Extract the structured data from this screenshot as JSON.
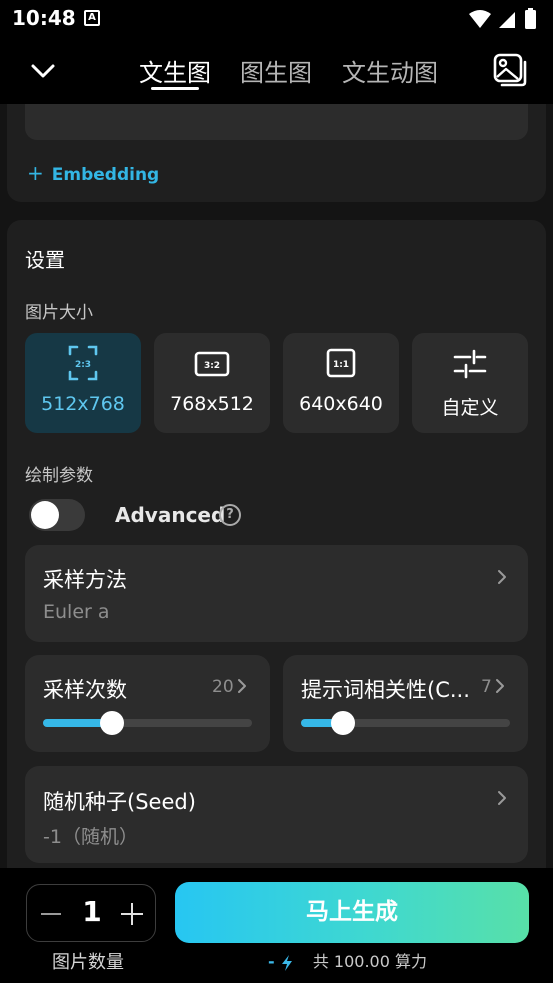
{
  "status_bar": {
    "time": "10:48",
    "notification_glyph": "A"
  },
  "nav": {
    "tabs": [
      {
        "label": "文生图",
        "active": true
      },
      {
        "label": "图生图",
        "active": false
      },
      {
        "label": "文生动图",
        "active": false
      }
    ]
  },
  "prompt_card": {
    "embedding_label": "Embedding",
    "embedding_plus": "+"
  },
  "settings": {
    "title": "设置",
    "size_label": "图片大小",
    "size_options": [
      {
        "ratio": "2:3",
        "label": "512x768",
        "selected": true
      },
      {
        "ratio": "3:2",
        "label": "768x512",
        "selected": false
      },
      {
        "ratio": "1:1",
        "label": "640x640",
        "selected": false
      },
      {
        "ratio": "",
        "label": "自定义",
        "selected": false
      }
    ],
    "draw_params_label": "绘制参数",
    "advanced": {
      "label": "Advanced",
      "help_glyph": "?",
      "enabled": false
    },
    "sampler": {
      "title": "采样方法",
      "value": "Euler a"
    },
    "steps": {
      "title": "采样次数",
      "value": "20",
      "fraction": 0.33
    },
    "cfg": {
      "title": "提示词相关性(C...",
      "value": "7",
      "fraction": 0.2
    },
    "seed": {
      "title": "随机种子(Seed)",
      "value": "-1（随机）"
    }
  },
  "bottom": {
    "quantity": "1",
    "quantity_label": "图片数量",
    "generate_label": "马上生成",
    "cost_prefix": "-",
    "cost_text": "共 100.00 算力"
  },
  "colors": {
    "accent": "#33b6e4",
    "selected_bg": "#163845",
    "gradient_start": "#27c6f2",
    "gradient_end": "#58e0a8"
  },
  "icons": [
    "chevron-down-icon",
    "gallery-icon",
    "aspect-ratio-icon",
    "sliders-icon",
    "help-icon",
    "chevron-right-icon",
    "bolt-icon",
    "wifi-icon",
    "signal-icon",
    "battery-icon"
  ]
}
